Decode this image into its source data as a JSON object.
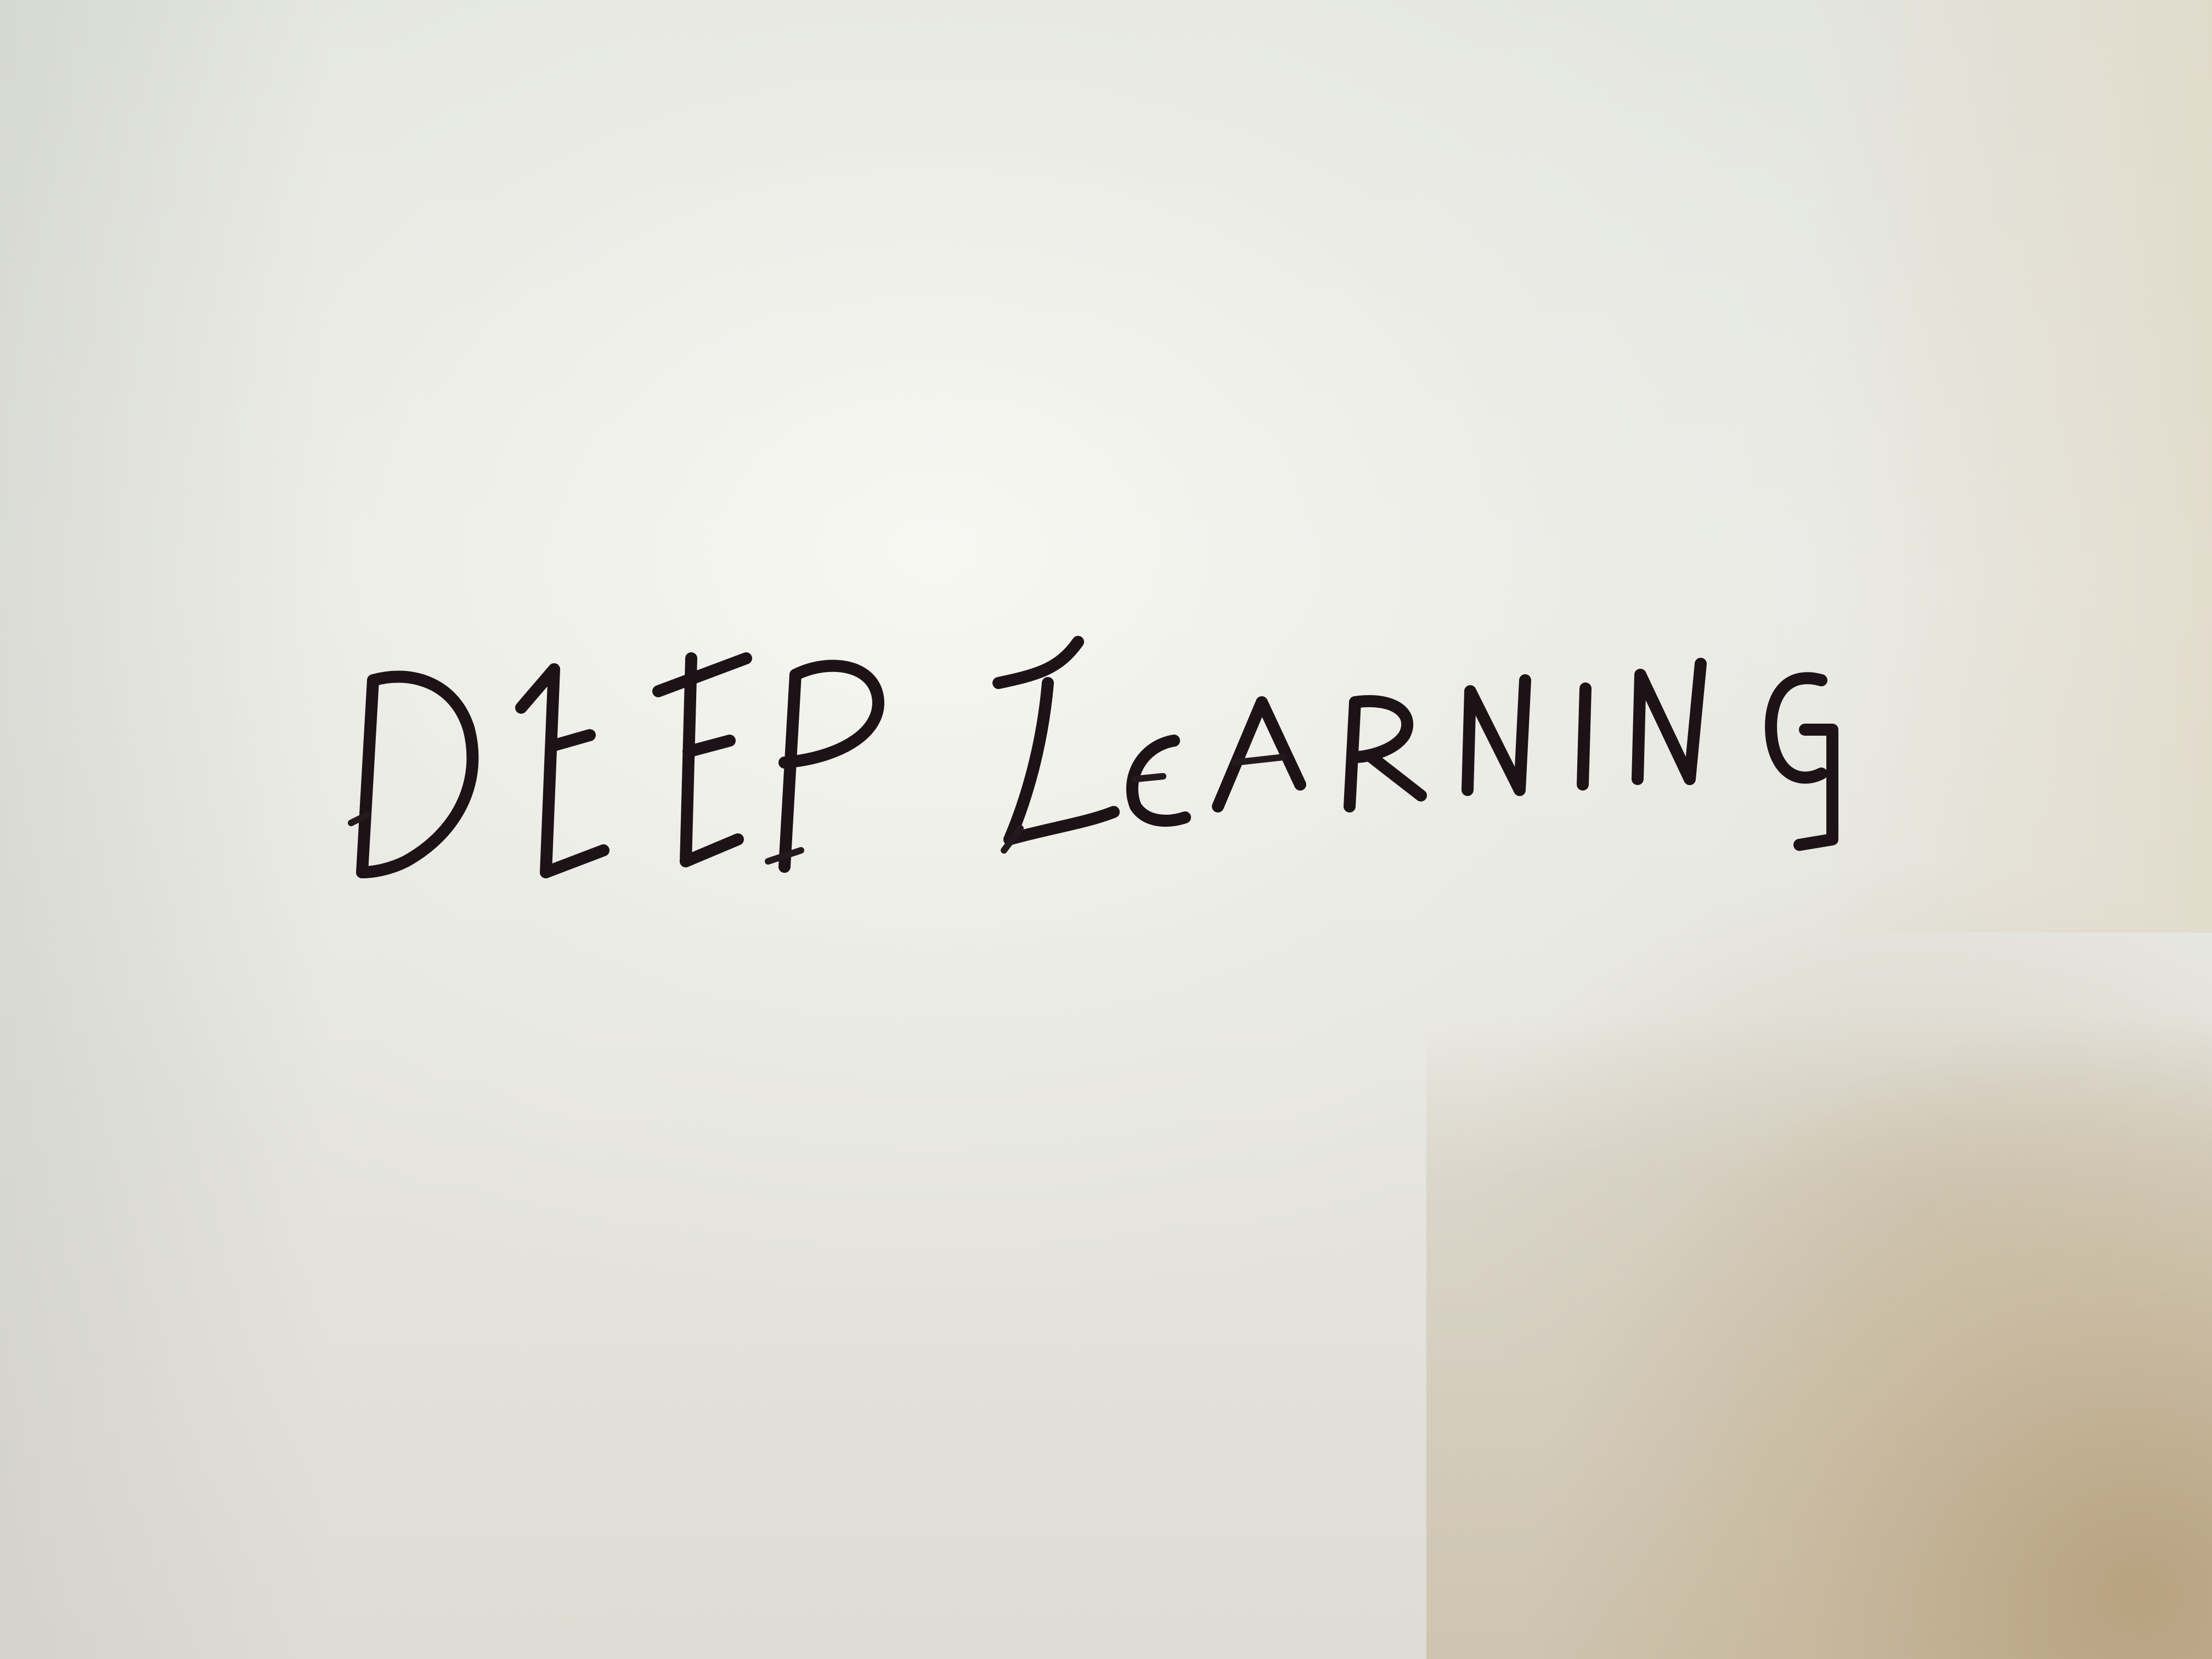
{
  "scene": {
    "subject": "handwritten-text-on-paper",
    "text": "DEEP LEARNING",
    "ink_color": "#1d1317",
    "paper_color": "#e9eae5",
    "shadow_color": "#b8a07a"
  }
}
